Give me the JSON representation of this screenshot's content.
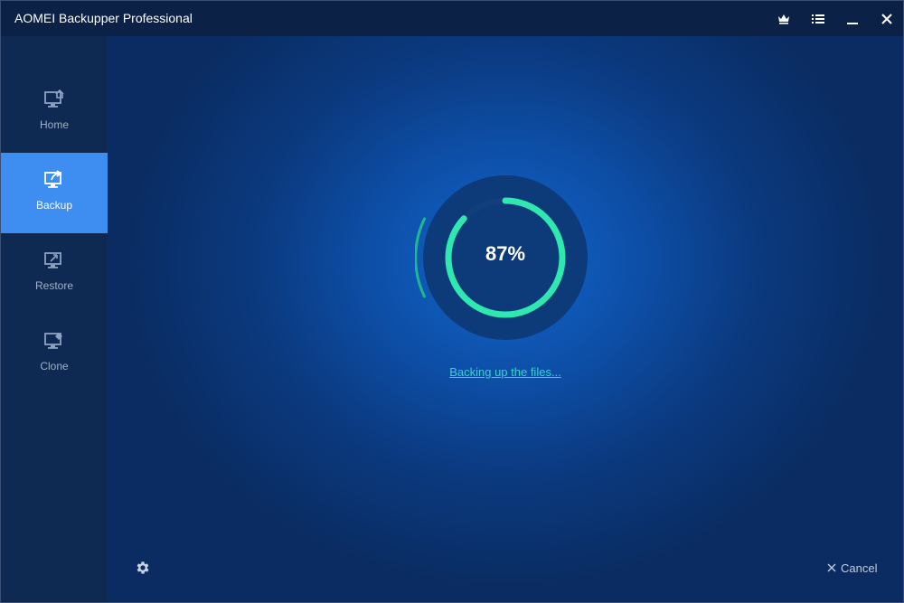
{
  "window": {
    "title": "AOMEI Backupper Professional"
  },
  "titlebar": {
    "buttons": [
      {
        "name": "upgrade",
        "icon": "crown-icon"
      },
      {
        "name": "menu",
        "icon": "menu-icon"
      },
      {
        "name": "minimize",
        "icon": "minimize-icon"
      },
      {
        "name": "close",
        "icon": "close-icon"
      }
    ]
  },
  "sidebar": {
    "items": [
      {
        "label": "Home",
        "icon": "home-icon",
        "active": false
      },
      {
        "label": "Backup",
        "icon": "backup-icon",
        "active": true
      },
      {
        "label": "Restore",
        "icon": "restore-icon",
        "active": false
      },
      {
        "label": "Clone",
        "icon": "clone-icon",
        "active": false
      }
    ]
  },
  "progress": {
    "percent_text": "87%",
    "value": 0.87,
    "status": "Backing up the files..."
  },
  "footer": {
    "settings_icon": "gear-icon",
    "cancel_label": "Cancel"
  },
  "colors": {
    "accent": "#3d8ef0",
    "progress": "#2ee8b0",
    "link": "#33d6c8"
  }
}
